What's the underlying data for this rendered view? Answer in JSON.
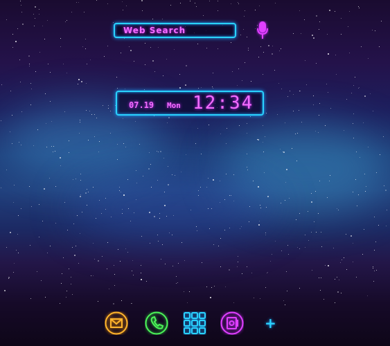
{
  "search": {
    "label": "Web Search",
    "icon": "microphone-icon"
  },
  "clock": {
    "date": "07.19",
    "day": "Mon",
    "time": "12:34"
  },
  "dock": [
    {
      "name": "mail",
      "icon": "mail-icon",
      "color": "#ffb52e"
    },
    {
      "name": "phone",
      "icon": "phone-icon",
      "color": "#4df25a"
    },
    {
      "name": "apps",
      "icon": "app-grid-icon",
      "color": "#2ad2ff"
    },
    {
      "name": "contacts",
      "icon": "contacts-icon",
      "color": "#e040ff"
    },
    {
      "name": "add",
      "icon": "plus-icon",
      "label": "+",
      "color": "#2ad2ff"
    }
  ],
  "colors": {
    "neon_pink": "#f36cff",
    "neon_blue": "#2ad2ff"
  }
}
